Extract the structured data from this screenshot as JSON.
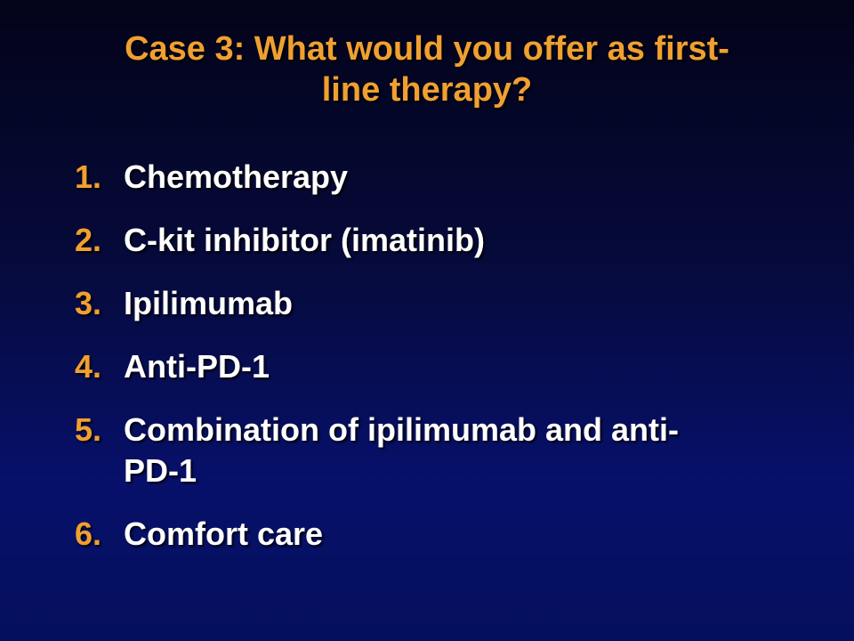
{
  "slide": {
    "title_line1": "Case 3: What would you offer as first-",
    "title_line2": "line therapy?",
    "colors": {
      "title": "#f0a030",
      "number": "#f0a030",
      "text": "#ffffff",
      "background": "#07106a"
    },
    "options": [
      {
        "number": "1.",
        "text": "Chemotherapy"
      },
      {
        "number": "2.",
        "text": "C-kit inhibitor (imatinib)"
      },
      {
        "number": "3.",
        "text": "Ipilimumab"
      },
      {
        "number": "4.",
        "text": "Anti-PD-1"
      },
      {
        "number": "5.",
        "text_line1": "Combination of ipilimumab and anti-",
        "text_line2": "PD-1"
      },
      {
        "number": "6.",
        "text": "Comfort care"
      }
    ]
  }
}
